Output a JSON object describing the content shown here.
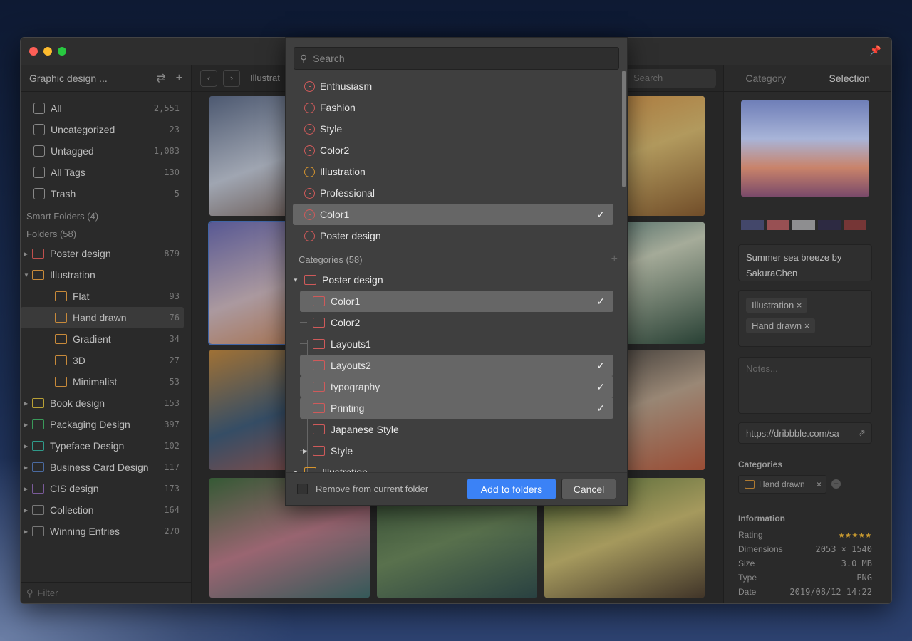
{
  "window": {
    "library": "Graphic design ...",
    "breadcrumb": "Illustrat",
    "search_placeholder": "Search"
  },
  "sidebar": {
    "items": [
      {
        "label": "All",
        "count": "2,551",
        "icon": "archive-icon"
      },
      {
        "label": "Uncategorized",
        "count": "23",
        "icon": "question-icon"
      },
      {
        "label": "Untagged",
        "count": "1,083",
        "icon": "untagged-icon"
      },
      {
        "label": "All Tags",
        "count": "130",
        "icon": "tag-icon"
      },
      {
        "label": "Trash",
        "count": "5",
        "icon": "trash-icon"
      }
    ],
    "smart_folders": "Smart Folders (4)",
    "folders_title": "Folders (58)",
    "folders": [
      {
        "label": "Poster design",
        "count": "879",
        "color": "#c0504d"
      },
      {
        "label": "Illustration",
        "count": "",
        "color": "#c88a3a",
        "expanded": true
      },
      {
        "label": "Flat",
        "count": "93",
        "color": "#c88a3a",
        "child": true
      },
      {
        "label": "Hand drawn",
        "count": "76",
        "color": "#c88a3a",
        "child": true,
        "selected": true
      },
      {
        "label": "Gradient",
        "count": "34",
        "color": "#c88a3a",
        "child": true
      },
      {
        "label": "3D",
        "count": "27",
        "color": "#c88a3a",
        "child": true
      },
      {
        "label": "Minimalist",
        "count": "53",
        "color": "#c88a3a",
        "child": true
      },
      {
        "label": "Book design",
        "count": "153",
        "color": "#b8a035"
      },
      {
        "label": "Packaging Design",
        "count": "397",
        "color": "#3a9a5a"
      },
      {
        "label": "Typeface Design",
        "count": "102",
        "color": "#2f9a8a"
      },
      {
        "label": "Business Card Design",
        "count": "117",
        "color": "#4a6aa0"
      },
      {
        "label": "CIS design",
        "count": "173",
        "color": "#7a5a9a"
      },
      {
        "label": "Collection",
        "count": "164",
        "color": "#777777"
      },
      {
        "label": "Winning Entries",
        "count": "270",
        "color": "#777777"
      }
    ],
    "filter_placeholder": "Filter"
  },
  "right": {
    "tab_category": "Category",
    "tab_selection": "Selection",
    "palette": [
      "#4a4f7a",
      "#b45a5e",
      "#a8a8aa",
      "#2e2a48",
      "#8a3a3a"
    ],
    "title": "Summer sea breeze by SakuraChen",
    "tags": [
      "Illustration",
      "Hand drawn"
    ],
    "notes_placeholder": "Notes...",
    "url": "https://dribbble.com/sa",
    "categories_label": "Categories",
    "category": "Hand drawn",
    "info_label": "Information",
    "info": [
      {
        "k": "Rating",
        "v": "★★★★★"
      },
      {
        "k": "Dimensions",
        "v": "2053 × 1540"
      },
      {
        "k": "Size",
        "v": "3.0 MB"
      },
      {
        "k": "Type",
        "v": "PNG"
      },
      {
        "k": "Date",
        "v": "2019/08/12 14:22"
      }
    ],
    "rating": 5
  },
  "dialog": {
    "search_placeholder": "Search",
    "recent": [
      {
        "label": "Enthusiasm",
        "color": "#d05a5a"
      },
      {
        "label": "Fashion",
        "color": "#d05a5a"
      },
      {
        "label": "Style",
        "color": "#d05a5a"
      },
      {
        "label": "Color2",
        "color": "#d05a5a"
      },
      {
        "label": "Illustration",
        "color": "#d8962e"
      },
      {
        "label": "Professional",
        "color": "#d05a5a"
      },
      {
        "label": "Color1",
        "color": "#d05a5a",
        "checked": true
      },
      {
        "label": "Poster design",
        "color": "#d05a5a"
      }
    ],
    "categories_title": "Categories (58)",
    "parent": "Poster design",
    "children": [
      {
        "label": "Color1",
        "checked": true
      },
      {
        "label": "Color2"
      },
      {
        "label": "Layouts1"
      },
      {
        "label": "Layouts2",
        "checked": true
      },
      {
        "label": "typography",
        "checked": true
      },
      {
        "label": "Printing",
        "checked": true
      },
      {
        "label": "Japanese Style"
      },
      {
        "label": "Style",
        "collapsed": true
      }
    ],
    "next_parent": "Illustration",
    "remove_label": "Remove from current folder",
    "remove_checked": false,
    "add_label": "Add to folders",
    "cancel_label": "Cancel",
    "check": "✓"
  }
}
